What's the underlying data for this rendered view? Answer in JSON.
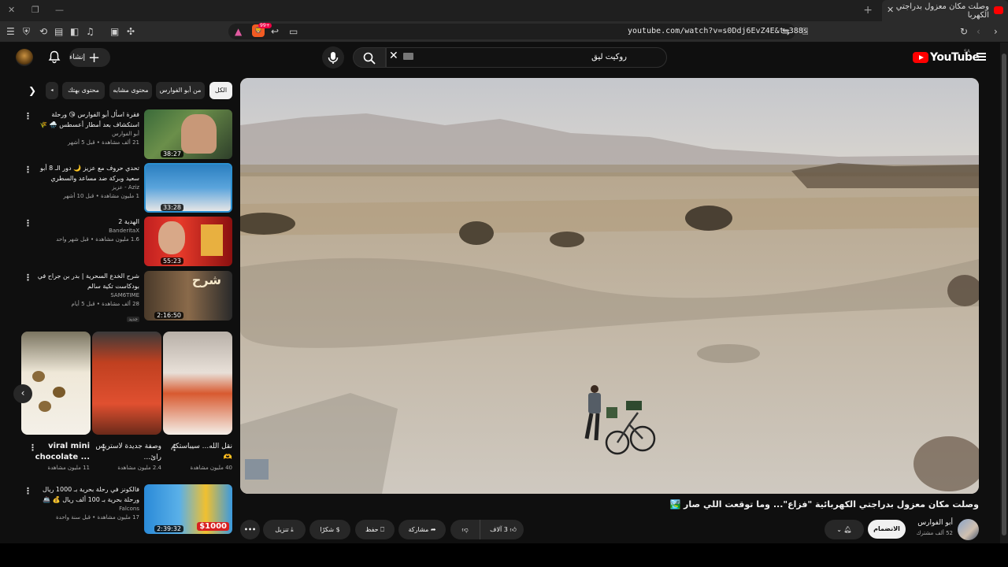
{
  "browser": {
    "tab_title": "وصلت مكان معزول بدراجتي الكهربا",
    "url": "youtube.com/watch?v=s0Ddj6EvZ4E&t=388s",
    "shield_count": "99+"
  },
  "header": {
    "logo_text": "YouTube",
    "country": "SA",
    "search_query": "روكيت ليق",
    "create_label": "إنشاء"
  },
  "chips": [
    "الكل",
    "من أبو الفوارس",
    "محتوى مشابه",
    "محتوى بهتك"
  ],
  "video": {
    "title": "وصلت مكان معزول بدراجتي الكهربائية \"فزاع\"... وما توقعت اللي صار 🏞️",
    "channel": "أبو الفوارس",
    "subscribers": "52 ألف مشترك",
    "join_label": "الانضمام",
    "likes": "3 آلاف",
    "share_label": "مشاركة",
    "save_label": "حفظ",
    "thanks_label": "شكرًا",
    "download_label": "تنزيل"
  },
  "recommendations": [
    {
      "title": "فقرة اسأل أبو الفوارس 😘 ورحلة استكشاف بعد أمطار أعسطس 🌧️ 🌾",
      "channel": "أبو الفوارس",
      "meta": "21 ألف مشاهدة • قبل 5 أشهر",
      "duration": "38:27"
    },
    {
      "title": "تحدي حروف مع عزيز 🌙 دور الـ 8 أبو سعيد وبركة ضد مساعد والسطري",
      "channel": "Aziz - عزيز",
      "meta": "1 مليون مشاهدة • قبل 10 أشهر",
      "duration": "33:28"
    },
    {
      "title": "الهدية 2",
      "channel": "BanderitaX",
      "meta": "1.6 مليون مشاهدة • قبل شهر واحد",
      "duration": "55:23"
    },
    {
      "title": "شرح الخدع السحرية | بدر بن جراح في بودكاست تكية سالم",
      "channel": "SAM6TIME",
      "meta": "28 ألف مشاهدة • قبل 5 أيام",
      "badge": "جديد",
      "duration": "2:16:50"
    },
    {
      "title": "فالكونز في رحلة بحرية بـ 1000 ريال ورحلة بحرية بـ 100 ألف ريال 💰 🚢",
      "channel": "Falcons",
      "meta": "17 مليون مشاهدة • قبل سنة واحدة",
      "duration": "2:39:32"
    }
  ],
  "shorts": [
    {
      "title": "نقل الله... سيباستكم 🫶",
      "views": "40 مليون مشاهدة"
    },
    {
      "title": "وصفة جديدة لاستريس رائ...",
      "views": "2.4 مليون مشاهدة"
    },
    {
      "title": "viral mini chocolate ...",
      "views": "11 مليون مشاهدة"
    }
  ],
  "colors": {
    "accent": "#ff0000",
    "bg": "#0f0f0f",
    "chip": "#272727"
  }
}
